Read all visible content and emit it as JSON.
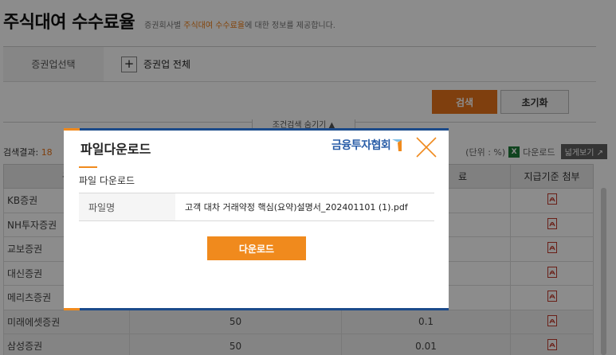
{
  "page": {
    "title": "주식대여 수수료율",
    "desc_pre": "증권회사별 ",
    "desc_highlight": "주식대여 수수료율",
    "desc_post": "에 대한 정보를 제공합니다."
  },
  "filter": {
    "label": "증권업선택",
    "plus": "+",
    "value": "증권업 전체",
    "search_label": "검색",
    "reset_label": "초기화",
    "toggle_label": "조건검색 숨기기 ▲"
  },
  "results": {
    "count_prefix": "검색결과: ",
    "count": "18",
    "unit": "(단위 : %)",
    "excel_icon": "excel-icon",
    "download_label": "다운로드",
    "wide_view_label": "넓게보기 ↗"
  },
  "table": {
    "headers": [
      "구",
      "",
      "료",
      "지급기준 첨부"
    ],
    "rows": [
      {
        "name": "KB증권",
        "a": "",
        "b": ""
      },
      {
        "name": "NH투자증권",
        "a": "",
        "b": ""
      },
      {
        "name": "교보증권",
        "a": "",
        "b": ""
      },
      {
        "name": "대신증권",
        "a": "",
        "b": ""
      },
      {
        "name": "메리츠증권",
        "a": "",
        "b": ""
      },
      {
        "name": "미래에셋증권",
        "a": "50",
        "b": "0.1"
      },
      {
        "name": "삼성증권",
        "a": "50",
        "b": "0.01"
      }
    ]
  },
  "modal": {
    "title": "파일다운로드",
    "logo_text": "금융투자협회",
    "section_title": "파일 다운로드",
    "file_label": "파일명",
    "file_name": "고객 대차 거래약정 핵심(요약)설명서_202401101 (1).pdf",
    "download_button": "다운로드"
  },
  "colors": {
    "accent_orange": "#f08a1d",
    "modal_border_blue": "#1b4a8a"
  }
}
